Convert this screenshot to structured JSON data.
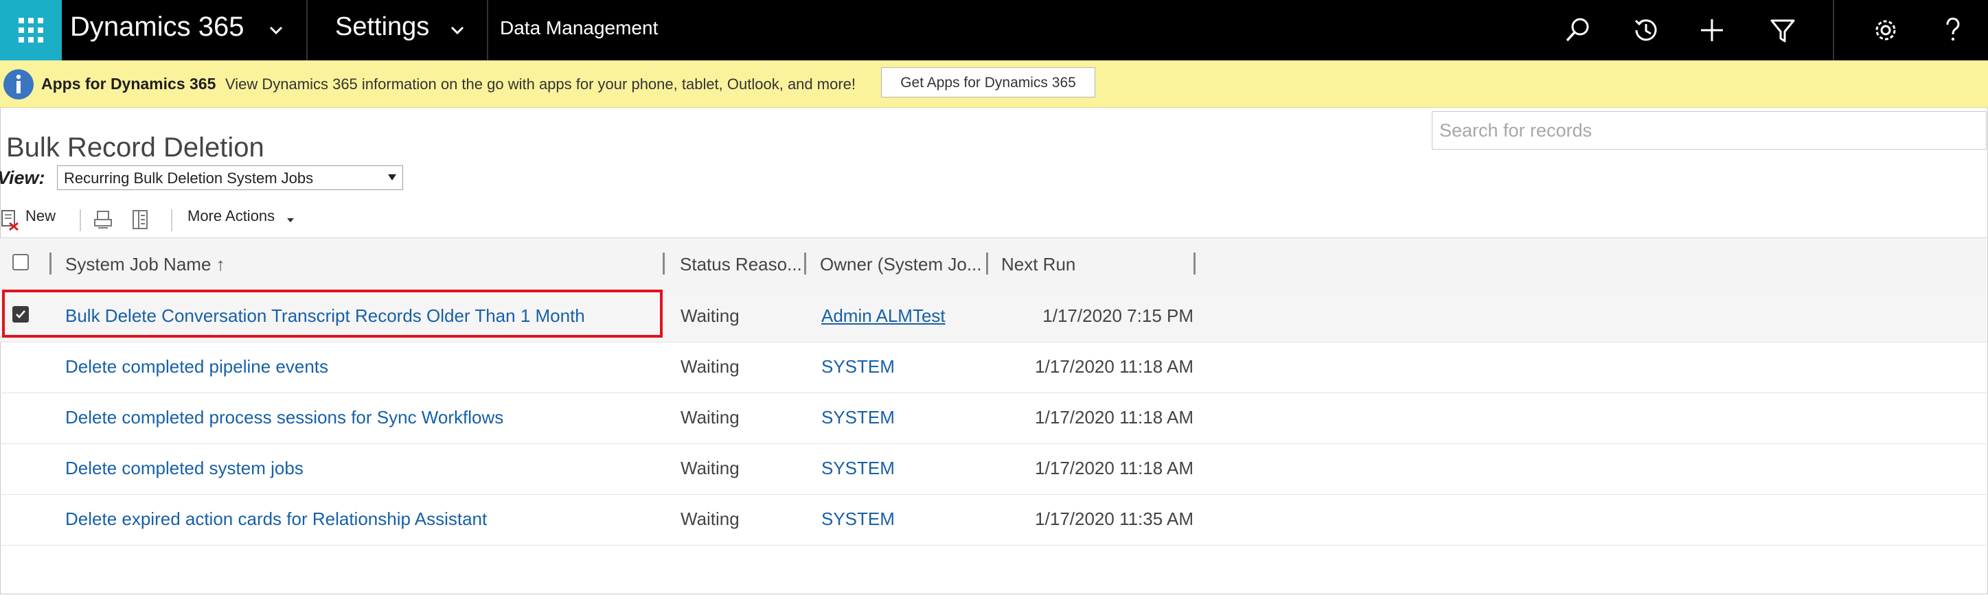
{
  "nav": {
    "app_name": "Dynamics 365",
    "area": "Settings",
    "section": "Data Management",
    "icons": [
      "search-icon",
      "recent-icon",
      "new-icon",
      "filter-icon",
      "settings-icon",
      "help-icon"
    ]
  },
  "notification": {
    "title": "Apps for Dynamics 365",
    "message": "View Dynamics 365 information on the go with apps for your phone, tablet, Outlook, and more!",
    "button_label": "Get Apps for Dynamics 365"
  },
  "page": {
    "title": "Bulk Record Deletion",
    "search_placeholder": "Search for records",
    "view_label": "View:",
    "view_value": "Recurring Bulk Deletion System Jobs"
  },
  "commands": {
    "new_label": "New",
    "more_actions_label": "More Actions"
  },
  "grid": {
    "columns": [
      "System Job Name",
      "Status Reaso...",
      "Owner (System Jo...",
      "Next Run"
    ],
    "sort_indicator": "↑",
    "rows": [
      {
        "name": "Bulk Delete Conversation Transcript Records Older Than 1 Month",
        "status": "Waiting",
        "owner": "Admin ALMTest",
        "next_run": "1/17/2020 7:15 PM",
        "selected": true
      },
      {
        "name": "Delete completed pipeline events",
        "status": "Waiting",
        "owner": "SYSTEM",
        "next_run": "1/17/2020 11:18 AM",
        "selected": false
      },
      {
        "name": "Delete completed process sessions for Sync Workflows",
        "status": "Waiting",
        "owner": "SYSTEM",
        "next_run": "1/17/2020 11:18 AM",
        "selected": false
      },
      {
        "name": "Delete completed system jobs",
        "status": "Waiting",
        "owner": "SYSTEM",
        "next_run": "1/17/2020 11:18 AM",
        "selected": false
      },
      {
        "name": "Delete expired action cards for Relationship Assistant",
        "status": "Waiting",
        "owner": "SYSTEM",
        "next_run": "1/17/2020 11:35 AM",
        "selected": false
      }
    ]
  },
  "colors": {
    "nav_bg": "#000000",
    "waffle_bg": "#1baec7",
    "notification_bg": "#fbf29c",
    "link": "#1760a8",
    "highlight": "#e0131f"
  }
}
